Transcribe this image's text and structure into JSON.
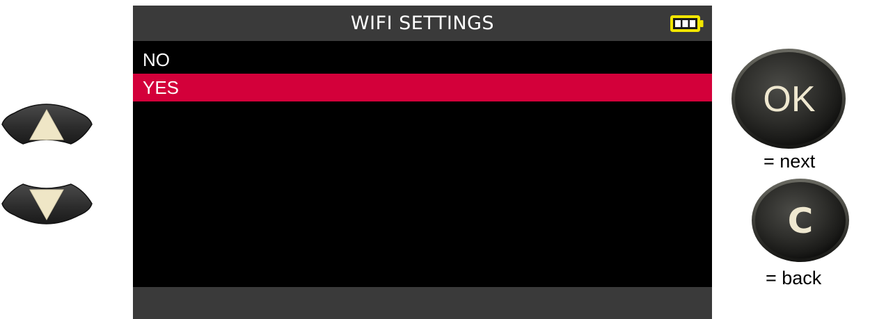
{
  "screen": {
    "title": "WIFI SETTINGS",
    "battery_icon": "battery-full-icon",
    "menu": [
      {
        "label": "NO",
        "selected": false
      },
      {
        "label": "YES",
        "selected": true
      }
    ]
  },
  "keys": {
    "up_icon": "up-arrow-key-icon",
    "down_icon": "down-arrow-key-icon",
    "ok_label": "OK",
    "ok_legend": "= next",
    "c_label": "C",
    "c_legend": "= back"
  },
  "colors": {
    "selection": "#d3003a",
    "bar": "#3a3a3a",
    "screen_bg": "#000000",
    "battery": "#f2e600"
  }
}
